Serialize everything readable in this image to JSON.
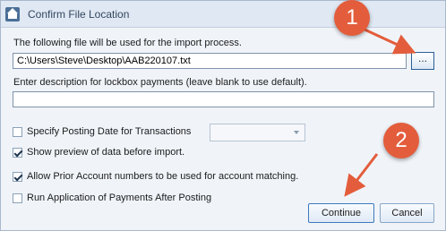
{
  "window": {
    "title": "Confirm File Location",
    "icon": "home-icon"
  },
  "file": {
    "label": "The following file will be used for the import process.",
    "path": "C:\\Users\\Steve\\Desktop\\AAB220107.txt",
    "browse_label": "..."
  },
  "description": {
    "label": "Enter description for lockbox payments (leave blank to use default).",
    "value": ""
  },
  "options": [
    {
      "label": "Specify Posting Date for Transactions",
      "checked": false
    },
    {
      "label": "Show preview of data before import.",
      "checked": true
    },
    {
      "label": "Allow Prior Account numbers to be used for account matching.",
      "checked": true
    },
    {
      "label": "Run Application of Payments After Posting",
      "checked": false
    }
  ],
  "posting_date": {
    "value": "",
    "enabled": false
  },
  "buttons": {
    "continue": "Continue",
    "cancel": "Cancel"
  },
  "annotations": [
    {
      "number": "1"
    },
    {
      "number": "2"
    }
  ],
  "colors": {
    "marker": "#e35d3c",
    "titlebar": "#dfe8f3",
    "body": "#f0f4f9"
  }
}
